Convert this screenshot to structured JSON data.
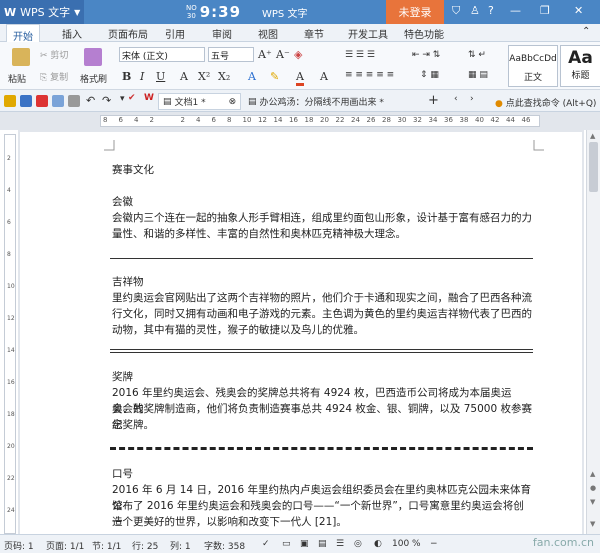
{
  "app": {
    "name": "WPS 文字",
    "time": "9:39",
    "date_top": "NO",
    "date_bottom": "30",
    "window_title": "WPS 文字",
    "login_label": "未登录"
  },
  "tabs": [
    "开始",
    "插入",
    "页面布局",
    "引用",
    "审阅",
    "视图",
    "章节",
    "开发工具",
    "特色功能"
  ],
  "ribbon": {
    "paste": "粘贴",
    "cut": "剪切",
    "copy": "复制",
    "format_painter": "格式刷",
    "font_name": "宋体 (正文)",
    "font_size": "五号",
    "style_normal_preview": "AaBbCcDd",
    "style_normal": "正文",
    "style_heading_preview": "Aa",
    "style_heading": "标题"
  },
  "doc_tabs": [
    {
      "label": "文档1 *"
    },
    {
      "label": "办公鸡汤：分隔线不用画出来 *"
    }
  ],
  "find_command": "点此查找命令 (Alt+Q)",
  "ruler": [
    "8",
    "6",
    "4",
    "2",
    "",
    "2",
    "4",
    "6",
    "8",
    "10",
    "12",
    "14",
    "16",
    "18",
    "20",
    "22",
    "24",
    "26",
    "28",
    "30",
    "32",
    "34",
    "36",
    "38",
    "40",
    "42",
    "44",
    "46"
  ],
  "vruler": [
    "2",
    "4",
    "6",
    "8",
    "10",
    "12",
    "14",
    "16",
    "18",
    "20",
    "22",
    "24"
  ],
  "document": {
    "heading": "赛事文化",
    "s1_title": "会徽",
    "s1_line1": "会徽内三个连在一起的抽象人形手臂相连，组成里约面包山形象，设计基于富有感召力的力",
    "s1_line2": "量性、和谐的多样性、丰富的自然性和奥林匹克精神极大理念。",
    "s2_title": "吉祥物",
    "s2_line1": "里约奥运会官网贴出了这两个吉祥物的照片，他们介于卡通和现实之间，融合了巴西各种流",
    "s2_line2": "行文化，同时又拥有动画和电子游戏的元素。主色调为黄色的里约奥运吉祥物代表了巴西的",
    "s2_line3": "动物，其中有猫的灵性，猴子的敏捷以及鸟儿的优雅。",
    "s3_title": "奖牌",
    "s3_line1": "2016 年里约奥运会、残奥会的奖牌总共将有 4924 枚，巴西造币公司将成为本届奥运会、残",
    "s3_line2": "奥会的奖牌制造商，他们将负责制造赛事总共 4924 枚金、银、铜牌，以及 75000 枚参赛纪",
    "s3_line3": "念奖牌。",
    "s4_title": "口号",
    "s4_line1": "2016 年 6 月 14 日，2016 年里约热内卢奥运会组织委员会在里约奥林匹克公园未来体育馆",
    "s4_line2": "公布了 2016 年里约奥运会和残奥会的口号——“一个新世界”，口号寓意里约奥运会将创造",
    "s4_line3": "一个更美好的世界，以影响和改变下一代人 [21]。"
  },
  "status": {
    "page": "页码: 1",
    "pages": "页面: 1/1",
    "section": "节: 1/1",
    "row": "行: 25",
    "col": "列: 1",
    "words": "字数: 358",
    "zoom": "100 %",
    "watermark": "fan.com.cn"
  }
}
